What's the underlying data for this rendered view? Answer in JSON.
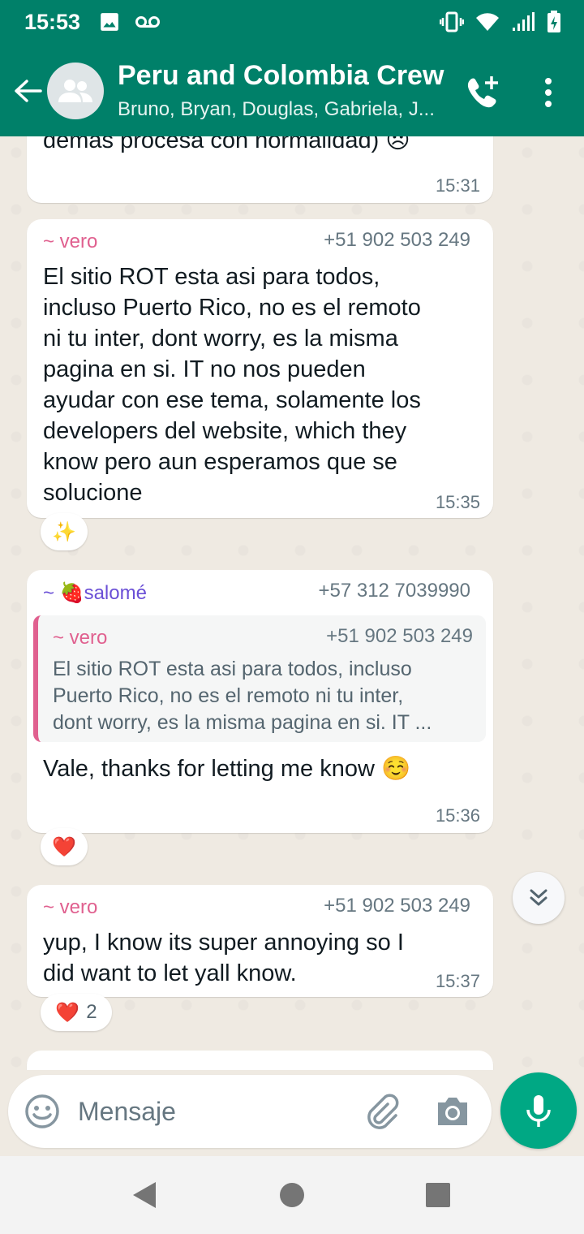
{
  "status": {
    "time": "15:53"
  },
  "header": {
    "title": "Peru and Colombia Crew",
    "subtitle": "Bruno, Bryan, Douglas, Gabriela, J..."
  },
  "messages": [
    {
      "text": "demas procesa con normalidad) 😞",
      "time": "15:31"
    },
    {
      "sender": "~ vero",
      "phone": "+51 902 503 249",
      "lines": [
        "El sitio ROT esta asi para todos,",
        "incluso Puerto Rico, no es el remoto",
        "ni tu inter, dont worry, es la misma",
        "pagina en si. IT no nos pueden",
        "ayudar con ese tema, solamente los",
        "developers del website, which they",
        "know pero aun esperamos que se",
        "solucione"
      ],
      "time": "15:35",
      "reaction": "✨"
    },
    {
      "sender": "~ 🍓salomé",
      "phone": "+57 312 7039990",
      "quote": {
        "sender": "~ vero",
        "phone": "+51 902 503 249",
        "lines": [
          "El sitio ROT esta asi para todos, incluso",
          "Puerto Rico, no es el remoto ni tu inter,",
          "dont worry, es la misma pagina en si. IT ..."
        ]
      },
      "text": "Vale, thanks for letting me know ☺️",
      "time": "15:36",
      "reaction": "❤️"
    },
    {
      "sender": "~ vero",
      "phone": "+51 902 503 249",
      "lines": [
        "yup, I know its super annoying so I",
        "did want to let yall know."
      ],
      "time": "15:37",
      "reaction": "❤️",
      "reaction_count": "2"
    }
  ],
  "composer": {
    "placeholder": "Mensaje"
  },
  "colors": {
    "header": "#008069",
    "vero": "#e0608f",
    "salome": "#6a4fd6",
    "mic": "#00a884"
  },
  "icons": [
    "back-arrow-icon",
    "group-avatar-icon",
    "add-call-icon",
    "more-vert-icon",
    "emoji-icon",
    "attach-icon",
    "camera-icon",
    "mic-icon",
    "double-chevron-down-icon"
  ]
}
